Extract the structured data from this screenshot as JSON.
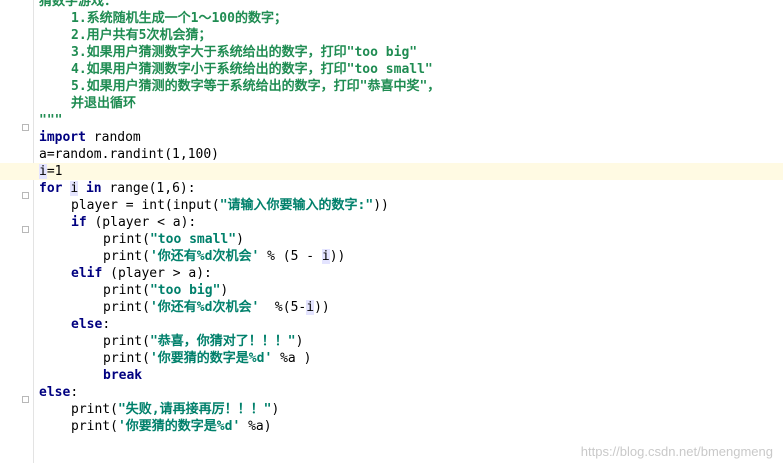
{
  "docstring": {
    "title": "猜数字游戏：",
    "rule1": "1.系统随机生成一个1～100的数字；",
    "rule2": "2.用户共有5次机会猜；",
    "rule3": "3.如果用户猜测数字大于系统给出的数字，打印\"too big\"",
    "rule4": "4.如果用户猜测数字小于系统给出的数字，打印\"too small\"",
    "rule5": "5.如果用户猜测的数字等于系统给出的数字，打印\"恭喜中奖\"，",
    "rule5b": "并退出循环",
    "close": "\"\"\""
  },
  "code": {
    "kw_import": "import",
    "module": " random",
    "assign_a": "a=random.randint(1,100)",
    "i_var": "i",
    "assign_i_rest": "=1",
    "kw_for": "for",
    "for_var": "i",
    "kw_in": "in",
    "range_part": " range(1,6):",
    "player_pre": "player = int(input(",
    "player_str": "\"请输入你要输入的数字:\"",
    "player_post": "))",
    "kw_if": "if",
    "if_cond": " (player < a):",
    "print_fn": "print(",
    "too_small": "\"too small\"",
    "close_paren": ")",
    "remain_str": "'你还有%d次机会'",
    "remain_fmt1": " % (5 - ",
    "remain_i": "i",
    "remain_end1": "))",
    "kw_elif": "elif",
    "elif_cond": " (player > a):",
    "too_big": "\"too big\"",
    "remain_fmt2": "  %(5-",
    "remain_end2": "))",
    "kw_else": "else",
    "colon": ":",
    "congrats": "\"恭喜，你猜对了！！！\"",
    "guess_str": "'你要猜的数字是%d'",
    "guess_fmt": " %a )",
    "kw_break": "break",
    "fail_str": "\"失败,请再接再厉！！！\"",
    "guess_fmt2": " %a)"
  },
  "watermark": "https://blog.csdn.net/bmengmeng"
}
